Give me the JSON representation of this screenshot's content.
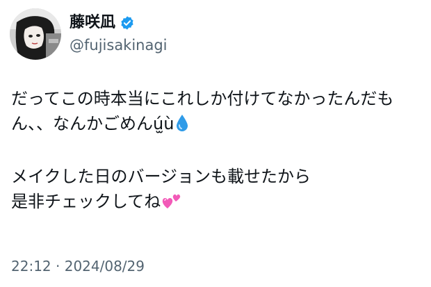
{
  "user": {
    "display_name": "藤咲凪",
    "handle": "@fujisakinagi",
    "verified": true,
    "verified_color": "#1d9bf0",
    "avatar_icon": "avatar-photo"
  },
  "tweet": {
    "line1": "だってこの時本当にこれしか付けてなかったんだも",
    "line2": "ん、、なんかごめんú̫ù",
    "line2_emoji": "droplet-icon",
    "line3": "メイクした日のバージョンも載せたから",
    "line4": "是非チェックしてね",
    "line4_emoji": "two-hearts-icon"
  },
  "meta": {
    "time": "22:12",
    "separator": " · ",
    "date": "2024/08/29"
  },
  "colors": {
    "text": "#0f1419",
    "secondary": "#536471",
    "droplet": "#2f9be8",
    "hearts": "#f25ab8"
  }
}
